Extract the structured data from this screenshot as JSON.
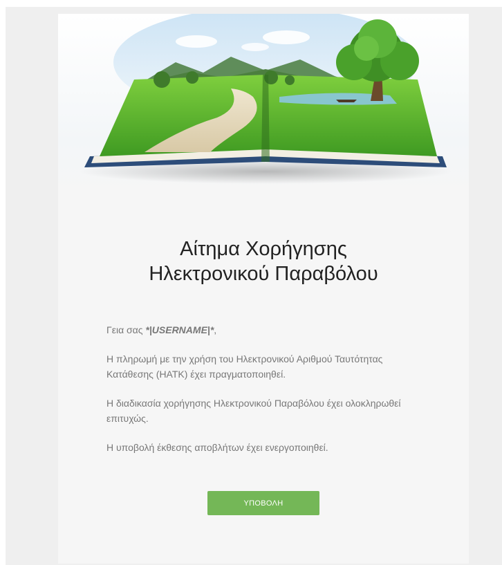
{
  "email": {
    "title_line1": "Αίτημα Χορήγησης",
    "title_line2": "Ηλεκτρονικού Παραβόλου",
    "greeting_prefix": "Γεια σας ",
    "greeting_username": "*|USERNAME|*",
    "greeting_suffix": ",",
    "paragraph1": "Η πληρωμή με την χρήση του Ηλεκτρονικού Αριθμού Ταυτότητας Κατάθεσης (ΗΑΤΚ) έχει πραγματοποιηθεί.",
    "paragraph2": "Η διαδικασία χορήγησης Ηλεκτρονικού Παραβόλου έχει ολοκληρωθεί επιτυχώς.",
    "paragraph3": "Η υποβολή έκθεσης αποβλήτων έχει ενεργοποιηθεί.",
    "submit_label": "ΥΠΟΒΟΛΗ"
  },
  "colors": {
    "page_background": "#efefef",
    "card_background": "#f6f6f6",
    "title_color": "#222222",
    "body_text_color": "#777777",
    "button_color": "#74b757",
    "button_text_color": "#ffffff"
  },
  "hero_image": {
    "subject": "open-book-landscape-illustration"
  }
}
